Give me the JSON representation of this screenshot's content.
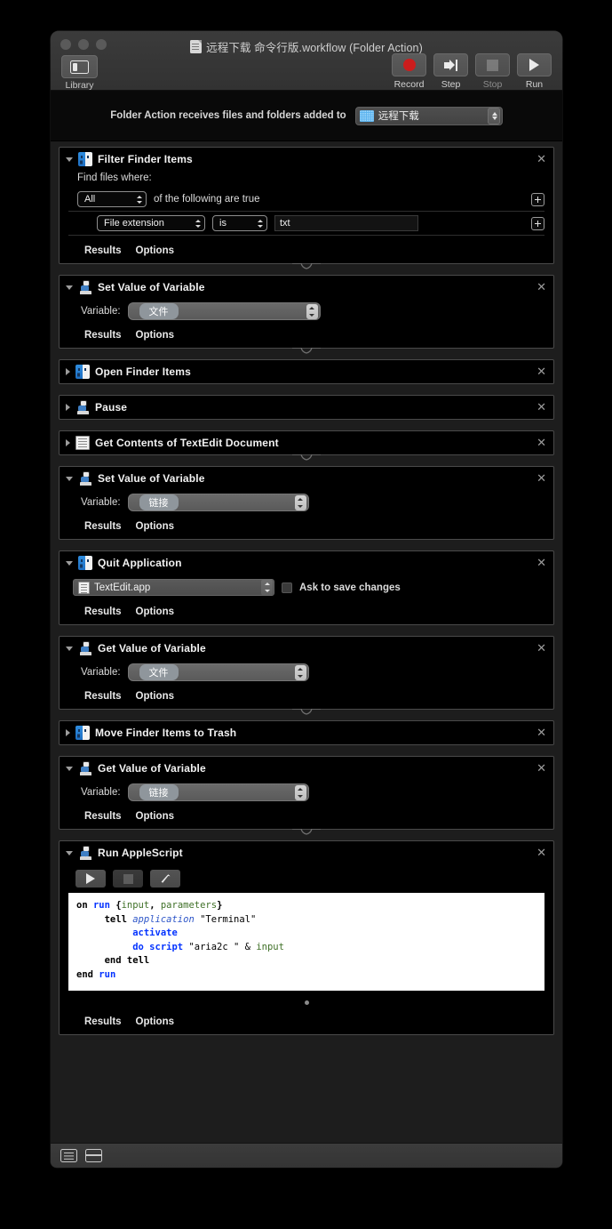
{
  "window": {
    "title": "远程下载 命令行版.workflow (Folder Action)",
    "traffic_lights": [
      "close",
      "minimize",
      "zoom"
    ]
  },
  "toolbar": {
    "library_label": "Library",
    "buttons": [
      {
        "name": "record",
        "label": "Record",
        "enabled": true
      },
      {
        "name": "step",
        "label": "Step",
        "enabled": true
      },
      {
        "name": "stop",
        "label": "Stop",
        "enabled": false
      },
      {
        "name": "run",
        "label": "Run",
        "enabled": true
      }
    ]
  },
  "header": {
    "label": "Folder Action receives files and folders added to",
    "folder_value": "远程下载"
  },
  "footer_labels": {
    "results": "Results",
    "options": "Options"
  },
  "actions": [
    {
      "title": "Filter Finder Items",
      "icon": "finder",
      "expanded": true,
      "find_label": "Find files where:",
      "match_value": "All",
      "match_suffix": "of the following are true",
      "rule": {
        "field": "File extension",
        "op": "is",
        "value": "txt"
      }
    },
    {
      "title": "Set Value of Variable",
      "icon": "robot",
      "expanded": true,
      "variable_label": "Variable:",
      "variable_value": "文件"
    },
    {
      "title": "Open Finder Items",
      "icon": "finder",
      "expanded": false
    },
    {
      "title": "Pause",
      "icon": "robot",
      "expanded": false
    },
    {
      "title": "Get Contents of TextEdit Document",
      "icon": "textedit",
      "expanded": false
    },
    {
      "title": "Set Value of Variable",
      "icon": "robot",
      "expanded": true,
      "variable_label": "Variable:",
      "variable_value": "链接"
    },
    {
      "title": "Quit Application",
      "icon": "finder",
      "expanded": true,
      "app_value": "TextEdit.app",
      "checkbox_label": "Ask to save changes",
      "checkbox_checked": false
    },
    {
      "title": "Get Value of Variable",
      "icon": "robot",
      "expanded": true,
      "variable_label": "Variable:",
      "variable_value": "文件"
    },
    {
      "title": "Move Finder Items to Trash",
      "icon": "finder",
      "expanded": false
    },
    {
      "title": "Get Value of Variable",
      "icon": "robot",
      "expanded": true,
      "variable_label": "Variable:",
      "variable_value": "链接"
    },
    {
      "title": "Run AppleScript",
      "icon": "robot",
      "expanded": true,
      "script_buttons": [
        "run-script",
        "stop-script",
        "compile-script"
      ],
      "script_lines": [
        "on run {input, parameters}",
        "    tell application \"Terminal\"",
        "        activate",
        "        do script \"aria2c \" & input",
        "    end tell",
        "end run"
      ]
    }
  ],
  "statusbar": {
    "view_modes": [
      "list-view",
      "split-view"
    ]
  },
  "colors": {
    "window_bg": "#1d1d1d",
    "action_bg": "#000000",
    "action_border": "#4a4a4a",
    "accent_blue": "#0433ff",
    "record_red": "#cc1d1d",
    "folder_blue": "#5db4ef"
  }
}
